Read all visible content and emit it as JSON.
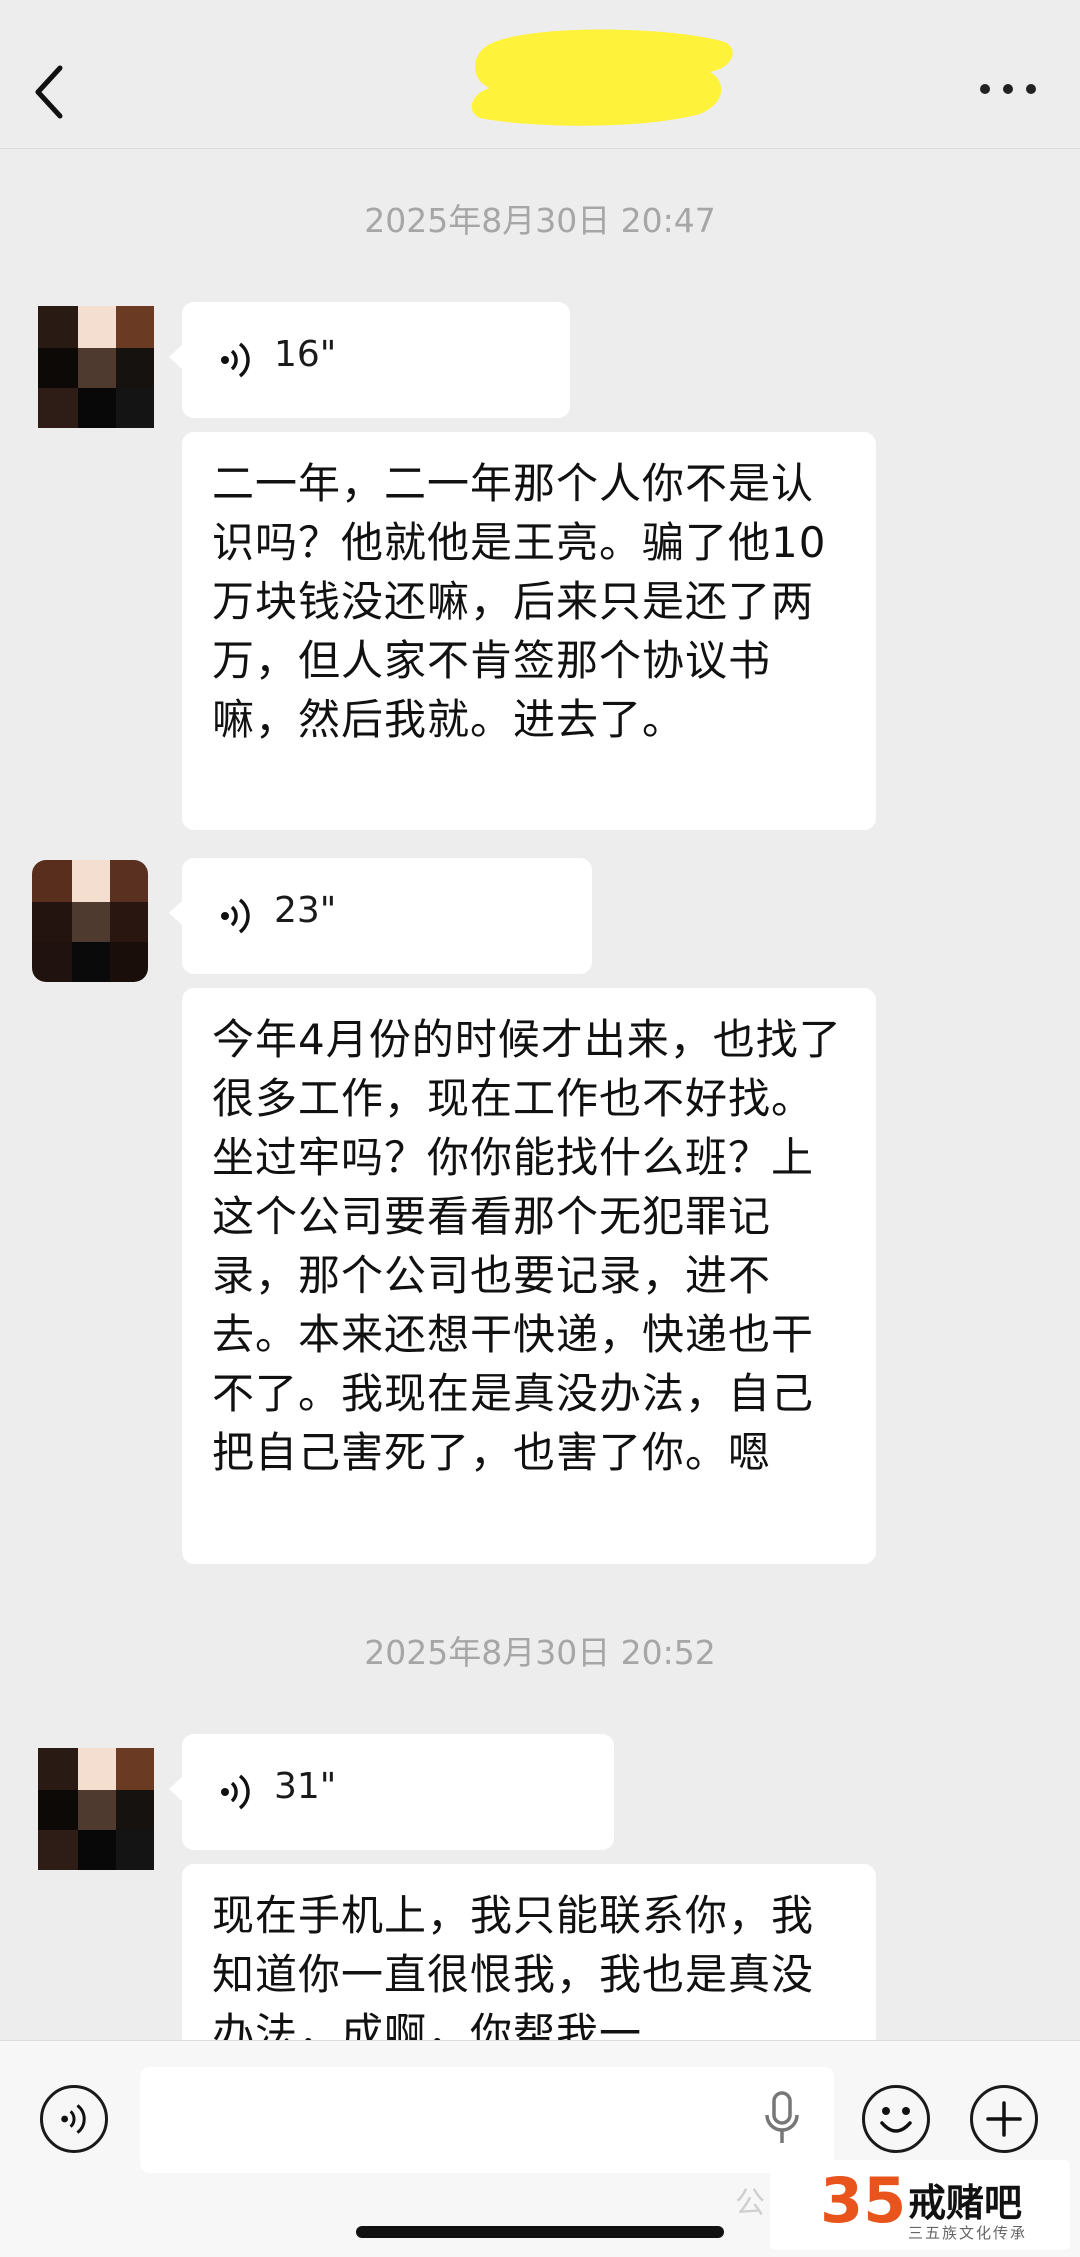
{
  "header": {
    "back_icon": "chevron-left-icon",
    "more_icon": "more-dots-icon",
    "title_redaction_color": "#fff23a"
  },
  "messages": [
    {
      "type": "timestamp",
      "text": "2025年8月30日 20:47"
    },
    {
      "type": "voice",
      "duration": "16\""
    },
    {
      "type": "transcript",
      "text": "二一年，二一年那个人你不是认识吗？他就他是王亮。骗了他10万块钱没还嘛，后来只是还了两万，但人家不肯签那个协议书嘛，然后我就。进去了。"
    },
    {
      "type": "voice",
      "duration": "23\""
    },
    {
      "type": "transcript",
      "text": "今年4月份的时候才出来，也找了很多工作，现在工作也不好找。坐过牢吗？你你能找什么班？上这个公司要看看那个无犯罪记录，那个公司也要记录，进不去。本来还想干快递，快递也干不了。我现在是真没办法，自己把自己害死了，也害了你。嗯"
    },
    {
      "type": "timestamp",
      "text": "2025年8月30日 20:52"
    },
    {
      "type": "voice",
      "duration": "31\""
    },
    {
      "type": "transcript",
      "text": "现在手机上，我只能联系你，我知道你一直很恨我，我也是真没办法，成啊，你帮我一"
    }
  ],
  "bottom_bar": {
    "voice_toggle_icon": "voice-mode-icon",
    "mic_icon": "microphone-icon",
    "emoji_icon": "emoji-icon",
    "add_icon": "plus-icon"
  },
  "watermark": {
    "number": "35",
    "name": "戒赌吧",
    "subtitle": "三五族文化传承",
    "left_text": "公"
  }
}
